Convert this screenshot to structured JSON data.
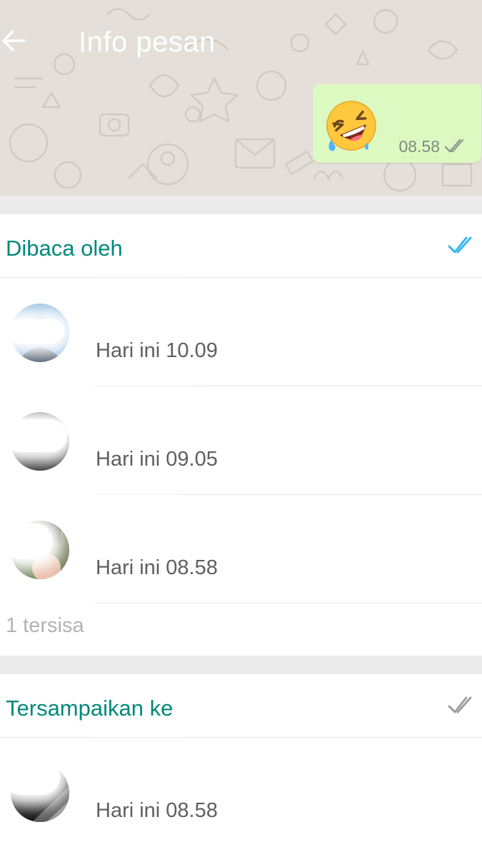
{
  "header": {
    "title": "Info pesan",
    "back_icon": "arrow-left-icon"
  },
  "message": {
    "emoji": "rolling-on-the-floor-laughing-emoji",
    "time": "08.58",
    "status_icon": "double-check-gray-icon"
  },
  "read": {
    "label": "Dibaca oleh",
    "tick_icon": "double-check-blue-icon",
    "tick_color": "#34b7f1",
    "contacts": [
      {
        "time": "Hari ini 10.09"
      },
      {
        "time": "Hari ini 09.05"
      },
      {
        "time": "Hari ini 08.58"
      }
    ],
    "remaining": "1 tersisa"
  },
  "delivered": {
    "label": "Tersampaikan ke",
    "tick_icon": "double-check-gray-icon",
    "contacts": [
      {
        "time": "Hari ini 08.58"
      }
    ]
  },
  "colors": {
    "accent": "#00897b",
    "bubble": "#ddf9c2",
    "wallpaper": "#e4dfd9"
  }
}
